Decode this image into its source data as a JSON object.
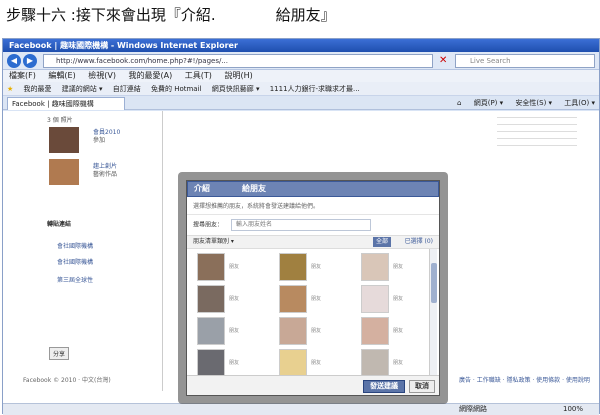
{
  "caption": "步驟十六 :接下來會出現『介紹.　　　　給朋友』",
  "window": {
    "title": "Facebook | 趣味國際機構 - Windows Internet Explorer",
    "url": "http://www.facebook.com/home.php?#!/pages/...",
    "search_placeholder": "Live Search"
  },
  "menu": [
    "檔案(F)",
    "編輯(E)",
    "檢視(V)",
    "我的最愛(A)",
    "工具(T)",
    "說明(H)"
  ],
  "favorites": [
    "我的最愛",
    "建議的網站 ▾",
    "自訂連結",
    "免費的 Hotmail",
    "網頁快訊藝廊 ▾",
    "1111人力銀行-求職求才最..."
  ],
  "tab": {
    "label": "Facebook | 趣味國際機構"
  },
  "toolbar": [
    "網頁(P) ▾",
    "安全性(S) ▾",
    "工具(O) ▾"
  ],
  "page": {
    "left_items": [
      "3 個 照片",
      "會員2010",
      "參加",
      "趨上創片",
      "藝術作品"
    ],
    "links_header": "轉貼連結",
    "links": [
      "會社國際機構",
      "會社國際機構",
      "第三屆全球性"
    ],
    "share": "分享",
    "footer": "Facebook © 2010 · 中文(台灣)",
    "footer_right": "廣告 · 工作職缺 · 隱私政策 · 使用條款 · 使用說明"
  },
  "status": {
    "zone": "網際網路",
    "zoom": "100%"
  },
  "dialog": {
    "title": "介紹　　　　給朋友",
    "subtitle": "選擇想推薦的朋友，系統將會發送建議給他們。",
    "search_label": "搜尋朋友：",
    "search_placeholder": "輸入朋友姓名",
    "filter_label": "朋友清單類別 ▾",
    "select_all": "全部",
    "selected_count": "已選擇 (0)",
    "send_label": "發送建議",
    "cancel_label": "取消",
    "friends": [
      {
        "name": "朋友",
        "color": "#8a6f5a"
      },
      {
        "name": "朋友",
        "color": "#a08040"
      },
      {
        "name": "朋友",
        "color": "#d9c6b8"
      },
      {
        "name": "朋友",
        "color": "#7a6a60"
      },
      {
        "name": "朋友",
        "color": "#b88a60"
      },
      {
        "name": "朋友",
        "color": "#e6dada"
      },
      {
        "name": "朋友",
        "color": "#9aa0a8"
      },
      {
        "name": "朋友",
        "color": "#c8a896"
      },
      {
        "name": "朋友",
        "color": "#d4b0a0"
      },
      {
        "name": "朋友",
        "color": "#6a6a70"
      },
      {
        "name": "朋友",
        "color": "#e8d090"
      },
      {
        "name": "朋友",
        "color": "#c0b8b0"
      }
    ]
  }
}
